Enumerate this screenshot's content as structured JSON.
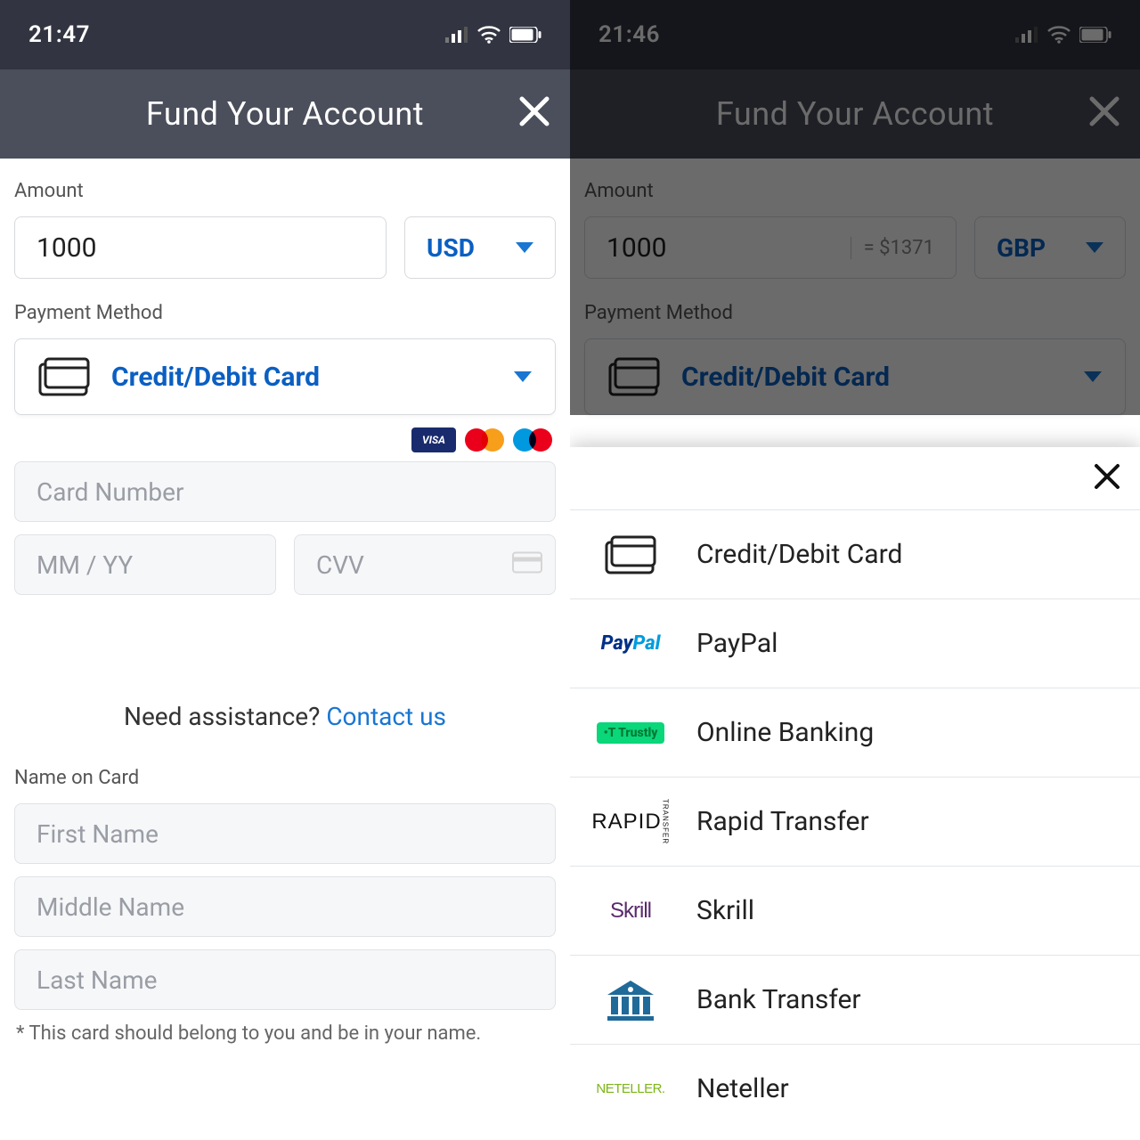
{
  "screen1": {
    "status_time": "21:47",
    "title": "Fund Your Account",
    "amount_label": "Amount",
    "amount_value": "1000",
    "currency": "USD",
    "pm_label": "Payment Method",
    "pm_selected": "Credit/Debit Card",
    "brands": {
      "visa": "VISA"
    },
    "card_number_ph": "Card Number",
    "expiry_ph": "MM / YY",
    "cvv_ph": "CVV",
    "assist_prefix": "Need assistance? ",
    "assist_link": "Contact us",
    "name_on_card_label": "Name on Card",
    "first_ph": "First Name",
    "middle_ph": "Middle Name",
    "last_ph": "Last Name",
    "footnote": "* This card should belong to you and be in your name."
  },
  "screen2": {
    "status_time": "21:46",
    "title": "Fund Your Account",
    "amount_label": "Amount",
    "amount_value": "1000",
    "conversion": "= $1371",
    "currency": "GBP",
    "pm_label": "Payment Method",
    "pm_selected": "Credit/Debit Card",
    "options": [
      {
        "key": "card",
        "label": "Credit/Debit Card"
      },
      {
        "key": "paypal",
        "label": "PayPal"
      },
      {
        "key": "online",
        "label": "Online Banking"
      },
      {
        "key": "rapid",
        "label": "Rapid Transfer"
      },
      {
        "key": "skrill",
        "label": "Skrill"
      },
      {
        "key": "bank",
        "label": "Bank Transfer"
      },
      {
        "key": "neteller",
        "label": "Neteller"
      }
    ]
  }
}
